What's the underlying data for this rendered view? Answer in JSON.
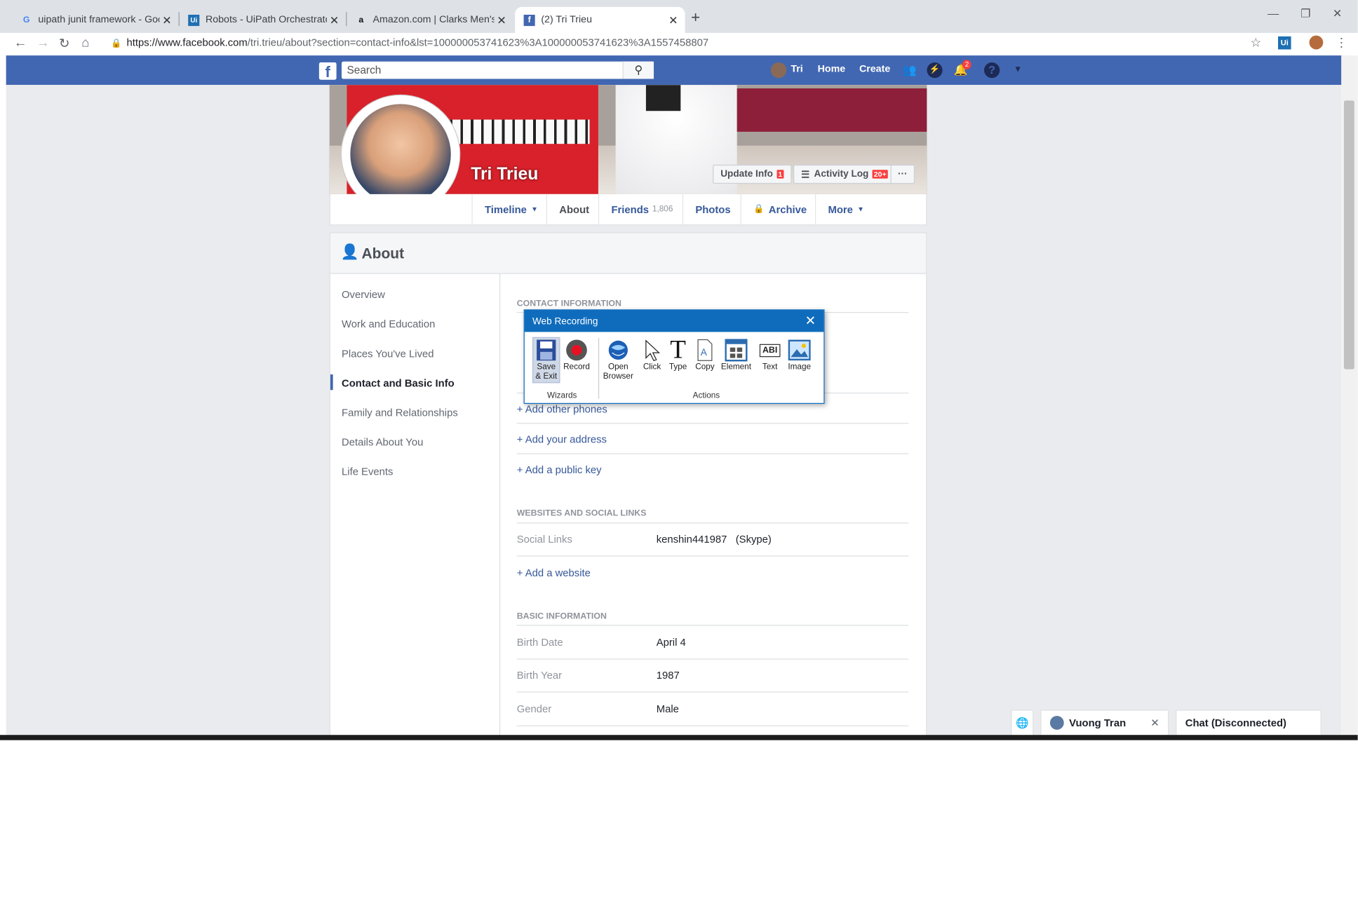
{
  "browser": {
    "tabs": [
      {
        "favicon": "G",
        "title": "uipath junit framework - Google"
      },
      {
        "favicon": "Ui",
        "title": "Robots - UiPath Orchestrator Co"
      },
      {
        "favicon": "a",
        "title": "Amazon.com | Clarks Men's Tilde"
      },
      {
        "favicon": "f",
        "title": "(2) Tri Trieu"
      }
    ],
    "url_host": "https://www.facebook.com",
    "url_path": "/tri.trieu/about?section=contact-info&lst=100000053741623%3A100000053741623%3A1557458807"
  },
  "fb": {
    "search_placeholder": "Search",
    "user": "Tri",
    "nav_home": "Home",
    "nav_create": "Create",
    "notif_count": "2"
  },
  "profile": {
    "name": "Tri Trieu",
    "update_info": "Update Info",
    "update_info_badge": "1",
    "activity_log": "Activity Log",
    "activity_log_badge": "20+",
    "more_dots": "···",
    "tabs": {
      "timeline": "Timeline",
      "about": "About",
      "friends": "Friends",
      "friends_count": "1,806",
      "photos": "Photos",
      "archive": "Archive",
      "more": "More"
    }
  },
  "about": {
    "title": "About",
    "left_nav": [
      "Overview",
      "Work and Education",
      "Places You've Lived",
      "Contact and Basic Info",
      "Family and Relationships",
      "Details About You",
      "Life Events"
    ],
    "contact_header": "CONTACT INFORMATION",
    "add_phones": "Add other phones",
    "add_address": "Add your address",
    "add_key": "Add a public key",
    "websites_header": "WEBSITES AND SOCIAL LINKS",
    "social_links_label": "Social Links",
    "social_links_value": "kenshin441987",
    "social_links_service": "(Skype)",
    "add_website": "Add a website",
    "basic_header": "BASIC INFORMATION",
    "birth_date_label": "Birth Date",
    "birth_date_value": "April 4",
    "birth_year_label": "Birth Year",
    "birth_year_value": "1987",
    "gender_label": "Gender",
    "gender_value": "Male"
  },
  "recorder": {
    "title": "Web Recording",
    "save": "Save & Exit",
    "record": "Record",
    "open_browser": "Open Browser",
    "click": "Click",
    "type": "Type",
    "copy": "Copy",
    "element": "Element",
    "text": "Text",
    "image": "Image",
    "group_wizards": "Wizards",
    "group_actions": "Actions"
  },
  "chat": {
    "contact": "Vuong Tran",
    "status": "Chat (Disconnected)"
  },
  "colors": {
    "fb_blue": "#4267b2",
    "link": "#365899",
    "recorder_blue": "#0f6cbd",
    "badge_red": "#fa3e3e"
  }
}
